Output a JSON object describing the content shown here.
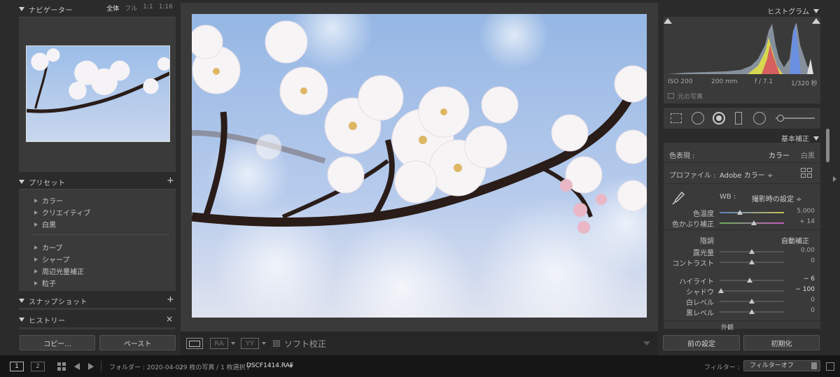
{
  "navigator": {
    "title": "ナビゲーター",
    "zoom_options": [
      "全体",
      "フル",
      "1:1",
      "1:16"
    ]
  },
  "presets": {
    "title": "プリセット",
    "add": "+",
    "groups_a": [
      "カラー",
      "クリエイティブ",
      "白黒"
    ],
    "groups_b": [
      "カーブ",
      "シャープ",
      "周辺光量補正",
      "粒子"
    ]
  },
  "snapshot": {
    "title": "スナップショット",
    "add": "+"
  },
  "history": {
    "title": "ヒストリー",
    "close": "×"
  },
  "left_buttons": {
    "copy": "コピー...",
    "paste": "ペースト"
  },
  "toolbar": {
    "ra_label": "RA",
    "yy_label": "YY",
    "softproof_label": "ソフト校正"
  },
  "histogram": {
    "title": "ヒストグラム",
    "iso": "ISO 200",
    "focal": "200 mm",
    "aperture": "f / 7.1",
    "shutter": "1/320 秒",
    "original_photo": "元の写真"
  },
  "basic": {
    "title": "基本補正",
    "treatment_label": "色表現 :",
    "treatment_color": "カラー",
    "treatment_bw": "白黒",
    "profile_label": "プロファイル :",
    "profile_value": "Adobe カラー ÷",
    "wb_label": "WB :",
    "wb_value": "撮影時の設定 ÷",
    "temp_label": "色温度",
    "temp_value": "5,000",
    "tint_label": "色かぶり補正",
    "tint_value": "+ 14",
    "tone_label": "階調",
    "auto_label": "自動補正",
    "exposure_label": "露光量",
    "exposure_value": "0.00",
    "contrast_label": "コントラスト",
    "contrast_value": "0",
    "highlights_label": "ハイライト",
    "highlights_value": "− 6",
    "shadows_label": "シャドウ",
    "shadows_value": "− 100",
    "whites_label": "白レベル",
    "whites_value": "0",
    "blacks_label": "黒レベル",
    "blacks_value": "0",
    "presence_label": "外観"
  },
  "right_buttons": {
    "previous": "前の設定",
    "reset": "初期化"
  },
  "filmstrip": {
    "view1": "1",
    "view2": "2",
    "folder_text": "フォルダー : 2020-04-02",
    "count_text": "29 枚の写真 / 1 枚選択 /",
    "filename": "DSCF1414.RAF",
    "filter_label": "フィルター :",
    "filter_value": "フィルターオフ"
  },
  "colors": {
    "panel_bg": "#3a3a3a",
    "app_bg": "#2b2b2b",
    "sky": "#9fbfe6",
    "blossom": "#f4f1f4"
  }
}
